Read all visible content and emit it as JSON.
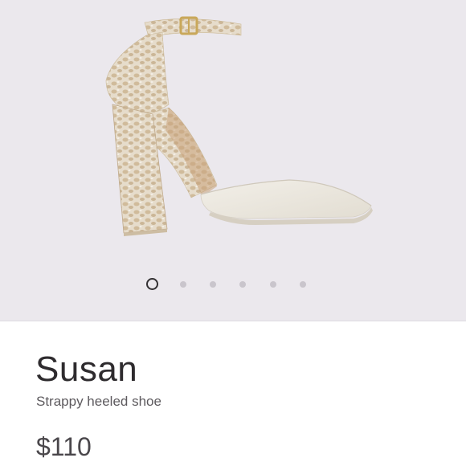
{
  "product": {
    "name": "Susan",
    "subtitle": "Strappy heeled shoe",
    "price": "$110"
  },
  "gallery": {
    "image_count": 6,
    "active_index": 0
  },
  "colors": {
    "gallery_background": "#ebe8ed",
    "leather": "#ebe6dc",
    "snakeskin": "#d8cab4",
    "buckle": "#c9a85a"
  }
}
